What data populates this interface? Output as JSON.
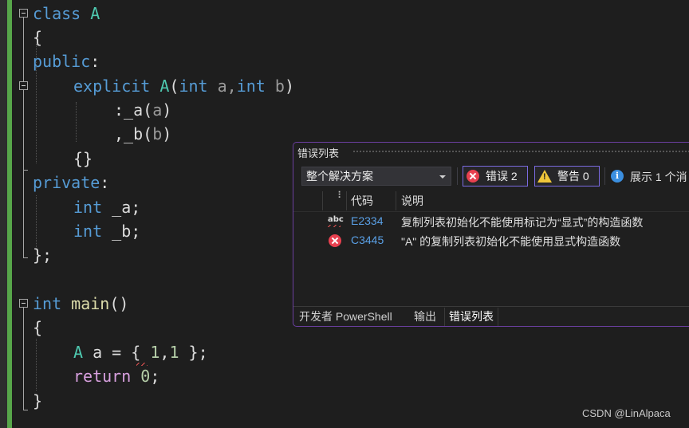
{
  "editor": {
    "lines": {
      "l1": {
        "kw": "class",
        "name": "A"
      },
      "l2": {
        "brace": "{"
      },
      "l3": {
        "kw": "public",
        "colon": ":"
      },
      "l4": {
        "kw": "explicit",
        "ctor": "A",
        "p1": "(",
        "t1": "int",
        "a": " a,",
        "t2": "int",
        "b": " b",
        "p2": ")"
      },
      "l5": {
        "colon": ":",
        "member": "_a",
        "paren_open": "(",
        "arg": "a",
        "paren_close": ")"
      },
      "l6": {
        "comma": ",",
        "member": "_b",
        "paren_open": "(",
        "arg": "b",
        "paren_close": ")"
      },
      "l7": {
        "braces": "{}"
      },
      "l8": {
        "kw": "private",
        "colon": ":"
      },
      "l9": {
        "type": "int",
        "name": " _a;"
      },
      "l10": {
        "type": "int",
        "name": " _b;"
      },
      "l11": {
        "close": "};"
      },
      "l13": {
        "type": "int",
        "fn": "main",
        "parens": "()"
      },
      "l14": {
        "brace": "{"
      },
      "l15": {
        "type": "A",
        "var": " a",
        "rest1": " = { ",
        "n1": "1",
        "comma": ",",
        "n2": "1",
        "rest2": " };"
      },
      "l16": {
        "kw": "return",
        "sp": " ",
        "n": "0",
        "semi": ";"
      },
      "l17": {
        "brace": "}"
      }
    }
  },
  "error_list": {
    "title": "错误列表",
    "scope": "整个解决方案",
    "errors_label": "错误 2",
    "warnings_label": "警告 0",
    "messages_label": "展示 1 个消",
    "info_glyph": "i",
    "warn_glyph": "!",
    "filter_glyph": "⠇",
    "columns": {
      "code": "代码",
      "description": "说明"
    },
    "rows": [
      {
        "icon": "spelling-error-icon",
        "abc": "abc",
        "code": "E2334",
        "description": "复制列表初始化不能使用标记为“显式”的构造函数"
      },
      {
        "icon": "error-icon",
        "code": "C3445",
        "description": "\"A\" 的复制列表初始化不能使用显式构造函数"
      }
    ],
    "tabs": [
      "开发者 PowerShell",
      "输出",
      "错误列表"
    ]
  },
  "watermark": "CSDN @LinAlpaca",
  "colors": {
    "keyword": "#569cd6",
    "type": "#4ec9b0",
    "function": "#dcdcaa",
    "error": "#e8404f",
    "warning": "#f0c63a",
    "accent": "#6b3fa0"
  }
}
